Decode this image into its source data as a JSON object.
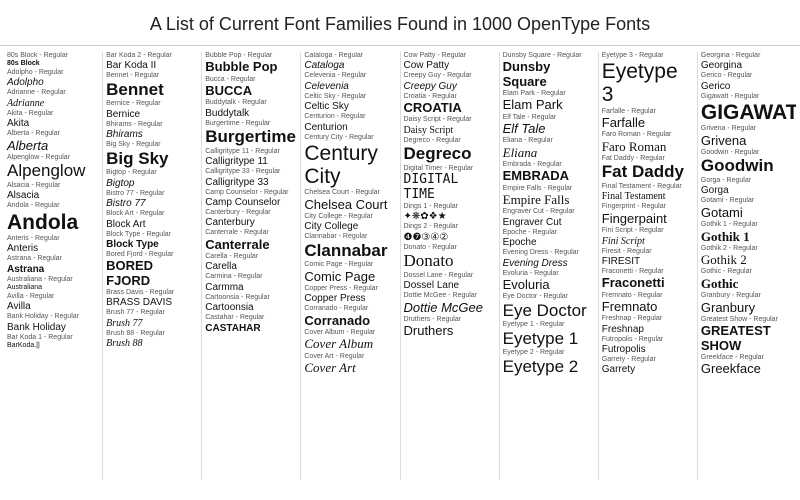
{
  "header": "A List of Current Font Families Found in 1000 OpenType Fonts",
  "columns": [
    {
      "id": "col1",
      "entries": [
        {
          "label": "80s Block - Regular",
          "display": "80s Block",
          "size": "tiny",
          "style": "bold"
        },
        {
          "label": "Adolpho - Regular",
          "display": "Adolpho",
          "size": "small",
          "style": "italic"
        },
        {
          "label": "Adrianne - Regular",
          "display": "Adrianne",
          "size": "small",
          "style": "italic"
        },
        {
          "label": "Akita - Regular",
          "display": "Akita",
          "size": "small"
        },
        {
          "label": "Alberta - Regular",
          "display": "Alberta",
          "size": "medium",
          "style": "italic"
        },
        {
          "label": "Alpenglow - Regular",
          "display": "Alpenglow",
          "size": "large"
        },
        {
          "label": "Alsacia - Regular",
          "display": "Alsacia",
          "size": "small"
        },
        {
          "label": "Andola - Regular",
          "display": "Andola",
          "size": "xlarge",
          "style": "bold"
        },
        {
          "label": "Anteris - Regular",
          "display": "Anteris",
          "size": "small"
        },
        {
          "label": "Astrana - Regular",
          "display": "Astrana",
          "size": "small",
          "style": "bold"
        },
        {
          "label": "Australiana - Regular",
          "display": "Australiana",
          "size": "tiny"
        },
        {
          "label": "Avilla - Regular",
          "display": "Avilla",
          "size": "small"
        },
        {
          "label": "Bank Holiday - Regular",
          "display": "Bank Holiday",
          "size": "small"
        },
        {
          "label": "Bar Koda 1 - Regular",
          "display": "BarKoda.||",
          "size": "tiny"
        }
      ]
    },
    {
      "id": "col2",
      "entries": [
        {
          "label": "Bar Koda 2 - Regular",
          "display": "Bar Koda II",
          "size": "small"
        },
        {
          "label": "Bennet - Regular",
          "display": "Bennet",
          "size": "large",
          "style": "bold"
        },
        {
          "label": "Bernice - Regular",
          "display": "Bernice",
          "size": "small"
        },
        {
          "label": "Bhirams - Regular",
          "display": "Bhirams",
          "size": "small",
          "style": "italic"
        },
        {
          "label": "Big Sky - Regular",
          "display": "Big Sky",
          "size": "large",
          "style": "bold"
        },
        {
          "label": "Bigtop - Regular",
          "display": "Bigtop",
          "size": "small",
          "style": "italic"
        },
        {
          "label": "Bistro 77 - Regular",
          "display": "Bistro 77",
          "size": "small",
          "style": "italic"
        },
        {
          "label": "Block Art - Regular",
          "display": "Block Art",
          "size": "small"
        },
        {
          "label": "Block Type - Regular",
          "display": "Block Type",
          "size": "small",
          "style": "bold"
        },
        {
          "label": "Bored Fjord - Regular",
          "display": "BORED FJORD",
          "size": "medium",
          "style": "bold"
        },
        {
          "label": "Brass Davis - Regular",
          "display": "BRASS DAVIS",
          "size": "small"
        },
        {
          "label": "Brush 77 - Regular",
          "display": "Brush 77",
          "size": "small",
          "style": "italic"
        },
        {
          "label": "Brush 88 - Regular",
          "display": "Brush 88",
          "size": "small",
          "style": "italic"
        }
      ]
    },
    {
      "id": "col3",
      "entries": [
        {
          "label": "Bubble Pop - Regular",
          "display": "Bubble Pop",
          "size": "medium",
          "style": "bold"
        },
        {
          "label": "Bucca - Regular",
          "display": "BUCCA",
          "size": "medium",
          "style": "bold"
        },
        {
          "label": "Buddytalk - Regular",
          "display": "Buddytalk",
          "size": "small"
        },
        {
          "label": "Burgertime - Regular",
          "display": "Burgertime",
          "size": "large",
          "style": "bold"
        },
        {
          "label": "Calligritype 11 - Regular",
          "display": "Calligritype 11",
          "size": "small"
        },
        {
          "label": "Calligritype 33 - Regular",
          "display": "Calligritype 33",
          "size": "small"
        },
        {
          "label": "Camp Counselor - Regular",
          "display": "Camp Counselor",
          "size": "small"
        },
        {
          "label": "Canterbury - Regular",
          "display": "Canterbury",
          "size": "small"
        },
        {
          "label": "Canterrale - Regular",
          "display": "Canterrale",
          "size": "medium",
          "style": "bold"
        },
        {
          "label": "Carella - Regular",
          "display": "Carella",
          "size": "small"
        },
        {
          "label": "Carmina - Regular",
          "display": "Carmma",
          "size": "small"
        },
        {
          "label": "Cartoonsia - Regular",
          "display": "Cartoonsia",
          "size": "small"
        },
        {
          "label": "Castahar - Regular",
          "display": "CASTAHAR",
          "size": "small",
          "style": "bold"
        }
      ]
    },
    {
      "id": "col4",
      "entries": [
        {
          "label": "Cataloga - Regular",
          "display": "Cataloga",
          "size": "small",
          "style": "italic"
        },
        {
          "label": "Celevenia - Regular",
          "display": "Celevenia",
          "size": "small",
          "style": "italic"
        },
        {
          "label": "Celtic Sky - Regular",
          "display": "Celtic Sky",
          "size": "small"
        },
        {
          "label": "Centurion - Regular",
          "display": "Centurion",
          "size": "small"
        },
        {
          "label": "Century City - Regular",
          "display": "Century City",
          "size": "xlarge"
        },
        {
          "label": "Chelsea Court - Regular",
          "display": "Chelsea Court",
          "size": "medium"
        },
        {
          "label": "City College - Regular",
          "display": "City College",
          "size": "small"
        },
        {
          "label": "Clannabar - Regular",
          "display": "Clannabar",
          "size": "large",
          "style": "bold"
        },
        {
          "label": "Comic Page - Regular",
          "display": "Comic Page",
          "size": "medium"
        },
        {
          "label": "Copper Press - Regular",
          "display": "Copper Press",
          "size": "small"
        },
        {
          "label": "Corranado - Regular",
          "display": "Corranado",
          "size": "medium",
          "style": "bold"
        },
        {
          "label": "Cover Album - Regular",
          "display": "Cover Album",
          "size": "medium",
          "style": "italic"
        },
        {
          "label": "Cover Art - Regular",
          "display": "Cover Art",
          "size": "medium",
          "style": "italic"
        }
      ]
    },
    {
      "id": "col5",
      "entries": [
        {
          "label": "Cow Patty - Regular",
          "display": "Cow Patty",
          "size": "small"
        },
        {
          "label": "Creepy Guy - Regular",
          "display": "Creepy Guy",
          "size": "small",
          "style": "italic"
        },
        {
          "label": "Croatia - Regular",
          "display": "CROATIA",
          "size": "medium",
          "style": "bold"
        },
        {
          "label": "Daisy Script - Regular",
          "display": "Daisy Script",
          "size": "small"
        },
        {
          "label": "Degreco - Regular",
          "display": "Degreco",
          "size": "large",
          "style": "bold"
        },
        {
          "label": "Digital Timer - Regular",
          "display": "DIGITAL TIME",
          "size": "medium"
        },
        {
          "label": "Dings 1 - Regular",
          "display": "✦❋✿❖★",
          "size": "small"
        },
        {
          "label": "Dings 2 - Regular",
          "display": "❹❼③④②",
          "size": "small"
        },
        {
          "label": "Donato - Regular",
          "display": "Donato",
          "size": "large"
        },
        {
          "label": "Dossel Lane - Regular",
          "display": "Dossel Lane",
          "size": "small"
        },
        {
          "label": "Dottie McGee - Regular",
          "display": "Dottie McGee",
          "size": "medium",
          "style": "italic"
        },
        {
          "label": "Druthers - Regular",
          "display": "Druthers",
          "size": "medium"
        }
      ]
    },
    {
      "id": "col6",
      "entries": [
        {
          "label": "Dunsby Square - Regular",
          "display": "Dunsby Square",
          "size": "medium",
          "style": "bold"
        },
        {
          "label": "Elam Park - Regular",
          "display": "Elam Park",
          "size": "medium"
        },
        {
          "label": "Elf Tale - Regular",
          "display": "Elf Tale",
          "size": "medium",
          "style": "italic"
        },
        {
          "label": "Eliana - Regular",
          "display": "Eliana",
          "size": "medium",
          "style": "italic"
        },
        {
          "label": "Embrada - Regular",
          "display": "EMBRADA",
          "size": "medium",
          "style": "bold"
        },
        {
          "label": "Empire Falls - Regular",
          "display": "Empire Falls",
          "size": "medium"
        },
        {
          "label": "Engraver Cut - Regular",
          "display": "Engraver Cut",
          "size": "small"
        },
        {
          "label": "Epoche - Regular",
          "display": "Epoche",
          "size": "small"
        },
        {
          "label": "Evening Dress - Regular",
          "display": "Evening Dress",
          "size": "small",
          "style": "italic"
        },
        {
          "label": "Evoluria - Regular",
          "display": "Evoluria",
          "size": "medium"
        },
        {
          "label": "Eye Doctor - Regular",
          "display": "Eye Doctor",
          "size": "large"
        },
        {
          "label": "Eyetype 1 - Regular",
          "display": "Eyetype 1",
          "size": "large"
        },
        {
          "label": "Eyetype 2 - Regular",
          "display": "Eyetype 2",
          "size": "large"
        }
      ]
    },
    {
      "id": "col7",
      "entries": [
        {
          "label": "Eyetype 3 - Regular",
          "display": "Eyetype 3",
          "size": "xlarge"
        },
        {
          "label": "Farfalle - Regular",
          "display": "Farfalle",
          "size": "medium"
        },
        {
          "label": "Faro Roman - Regular",
          "display": "Faro Roman",
          "size": "medium"
        },
        {
          "label": "Fat Daddy - Regular",
          "display": "Fat Daddy",
          "size": "large",
          "style": "bold"
        },
        {
          "label": "Final Testament - Regular",
          "display": "Final Testament",
          "size": "small"
        },
        {
          "label": "Fingerprint - Regular",
          "display": "Fingerpaint",
          "size": "medium"
        },
        {
          "label": "Fini Script - Regular",
          "display": "Fini Script",
          "size": "small",
          "style": "italic"
        },
        {
          "label": "Firesit - Regular",
          "display": "FIRESIT",
          "size": "small"
        },
        {
          "label": "Fraconetti - Regular",
          "display": "Fraconetti",
          "size": "medium",
          "style": "bold"
        },
        {
          "label": "Fremnato - Regular",
          "display": "Fremnato",
          "size": "medium"
        },
        {
          "label": "Freshnap - Regular",
          "display": "Freshnap",
          "size": "small"
        },
        {
          "label": "Futropolis - Regular",
          "display": "Futropolis",
          "size": "small"
        },
        {
          "label": "Garrety - Regular",
          "display": "Garrety",
          "size": "small"
        }
      ]
    },
    {
      "id": "col8",
      "entries": [
        {
          "label": "Georgina - Regular",
          "display": "Georgina",
          "size": "small"
        },
        {
          "label": "Gerico - Regular",
          "display": "Gerico",
          "size": "small"
        },
        {
          "label": "Gigawatt - Regular",
          "display": "GIGAWATT",
          "size": "xlarge",
          "style": "bold"
        },
        {
          "label": "Grivena - Regular",
          "display": "Grivena",
          "size": "medium"
        },
        {
          "label": "Goodwin - Regular",
          "display": "Goodwin",
          "size": "large",
          "style": "bold"
        },
        {
          "label": "Gorga - Regular",
          "display": "Gorga",
          "size": "small"
        },
        {
          "label": "Gotami - Regular",
          "display": "Gotami",
          "size": "medium"
        },
        {
          "label": "Gothik 1 - Regular",
          "display": "Gothik 1",
          "size": "medium",
          "style": "bold"
        },
        {
          "label": "Gothik 2 - Regular",
          "display": "Gothik 2",
          "size": "medium"
        },
        {
          "label": "Gothic - Regular",
          "display": "Gothic",
          "size": "medium",
          "style": "bold"
        },
        {
          "label": "Granbury - Regular",
          "display": "Granbury",
          "size": "medium"
        },
        {
          "label": "Greatest Show - Regular",
          "display": "GREATEST SHOW",
          "size": "medium",
          "style": "bold"
        },
        {
          "label": "Greekface - Regular",
          "display": "Greekface",
          "size": "medium"
        }
      ]
    }
  ]
}
